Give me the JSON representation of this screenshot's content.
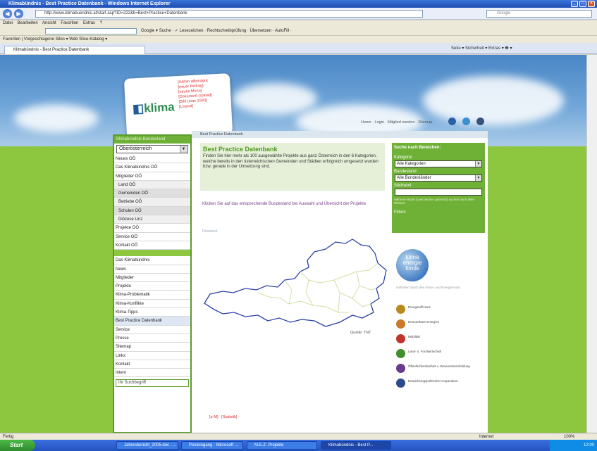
{
  "browser": {
    "title": "Klimabündnis - Best Practice Datenbank - Windows Internet Explorer",
    "address": "http://www.klimabuendnis.at/start.asp?ID=222&b=Best+Practice+Datenbank",
    "search_placeholder": "Google",
    "menu": "Datei  Bearbeiten  Ansicht  Favoriten  Extras  ?",
    "google_bar": "Google  ▾  Suche ·  ✓  Lesezeichen  ·  Rechtschreibprüfung  ·  Übersetzen  ·  AutoFill  ·",
    "favorites": "Favoriten   |   Vorgeschlagene Sites ▾   Web Slice-Katalog ▾",
    "tab_label": "Klimabündnis - Best Practice Datenbank",
    "command_bar": "Seite ▾  Sicherheit ▾  Extras ▾  ❷ ▾",
    "status_left": "Fertig",
    "status_zone": "Internet",
    "status_zoom": "100%"
  },
  "logo": {
    "text": "klima",
    "admin_links": [
      "[Admin allemagu]",
      "[neuer Beitrag]",
      "[neues Menü]",
      "[Dokument-Upload]",
      "[Bild (max 15M)]",
      "[Logout]"
    ]
  },
  "top_links": "Home · Login · Mitglied werden · Sitemap",
  "sidebar": {
    "header": "Klimabündnis Bundesland",
    "select_value": "Oberösterreich",
    "region_items": [
      {
        "label": "Neues OÖ",
        "kind": ""
      },
      {
        "label": "Das Klimabündnis OÖ",
        "kind": ""
      },
      {
        "label": "Mitglieder OÖ",
        "kind": ""
      },
      {
        "label": "Land OÖ",
        "kind": "sub"
      },
      {
        "label": "Gemeinden OÖ",
        "kind": "sub2"
      },
      {
        "label": "Betriebe OÖ",
        "kind": "sub"
      },
      {
        "label": "Schulen OÖ",
        "kind": "sub2"
      },
      {
        "label": "Diözese Linz",
        "kind": "sub"
      },
      {
        "label": "Projekte OÖ",
        "kind": ""
      },
      {
        "label": "Service OÖ",
        "kind": ""
      },
      {
        "label": "Kontakt OÖ",
        "kind": ""
      }
    ],
    "main_items": [
      {
        "label": "Das Klimabündnis",
        "kind": ""
      },
      {
        "label": "News",
        "kind": ""
      },
      {
        "label": "Mitglieder",
        "kind": ""
      },
      {
        "label": "Projekte",
        "kind": ""
      },
      {
        "label": "Klima-Problematik",
        "kind": ""
      },
      {
        "label": "Klima-Konflikte",
        "kind": ""
      },
      {
        "label": "Klima-Tipps",
        "kind": ""
      },
      {
        "label": "Best Practice Datenbank",
        "kind": "active"
      },
      {
        "label": "Service",
        "kind": ""
      },
      {
        "label": "Presse",
        "kind": ""
      },
      {
        "label": "Sitemap",
        "kind": ""
      },
      {
        "label": "Links",
        "kind": ""
      },
      {
        "label": "Kontakt",
        "kind": ""
      },
      {
        "label": "Intern",
        "kind": ""
      }
    ],
    "search_placeholder": "Ihr Suchbegriff"
  },
  "content": {
    "breadcrumb": "Best Practice Datenbank",
    "heading": "Best Practice Datenbank",
    "intro": "Finden Sie hier mehr als 100 ausgewählte Projekte aus ganz Österreich in den 6 Kategorien, welche bereits in den österreichischen Gemeinden und Städten erfolgreich umgesetzt wurden bzw. gerade in der Umsetzung sind.",
    "map_hint": "Klicken Sie auf das entsprechende Bundesland bei Auswahl und Übersicht der Projekte",
    "deselect": "Deselect",
    "source": "Quelle: TNT",
    "pager": "[a-M]  [Statistik]"
  },
  "filter": {
    "title": "Suche nach Bereichen:",
    "category_label": "Kategorie",
    "category_value": "Alle Kategorien",
    "state_label": "Bundesland",
    "state_value": "Alle Bundesländer",
    "keyword_label": "Stichwort",
    "keyword_value": "",
    "hint": "Mehrere Worte (Leerzeichen getrennt) suchen nach allen Wörtern",
    "submit": "Filtern"
  },
  "kef": {
    "text": "klima energie fonds",
    "sub": "Gefördert durch den Klima- und Energiefonds"
  },
  "legend": [
    {
      "label": "Energieeffizienz",
      "color": "#b88a1e"
    },
    {
      "label": "Erneuerbare Energien",
      "color": "#c97a2a"
    },
    {
      "label": "Mobilität",
      "color": "#c0362c"
    },
    {
      "label": "Land- u. Forstwirtschaft",
      "color": "#3f8f2a"
    },
    {
      "label": "Öffentlichkeitsarbeit u. Bewusstseinsbildung",
      "color": "#6a3a8c"
    },
    {
      "label": "Entwicklungspolitische Kooperation",
      "color": "#2e4a8f"
    }
  ],
  "taskbar": {
    "start": "Start",
    "tasks": [
      "Jahresbericht_2005.doc - ...",
      "Posteingang - Microsoft ...",
      "M.E.Z. Projekte",
      "Klimabündnis - Best P..."
    ],
    "clock": "12:00"
  }
}
